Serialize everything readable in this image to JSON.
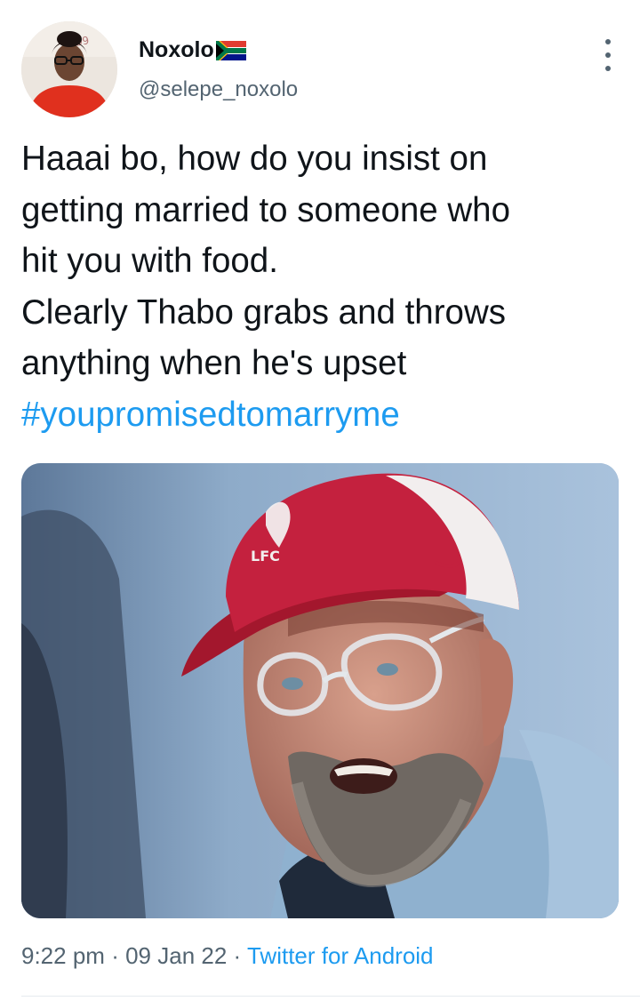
{
  "tweet": {
    "display_name": "Noxolo",
    "flag_icon": "south-africa-flag-icon",
    "handle": "@selepe_noxolo",
    "text_lines": [
      "Haaai bo, how do you insist on",
      "getting married to someone who",
      "hit you with food.",
      "Clearly Thabo grabs and throws",
      "anything when he's upset"
    ],
    "hashtag": "#youpromisedtomarryme",
    "cap_text": "LFC",
    "time": "9:22 pm",
    "separator": "·",
    "date": "09 Jan 22",
    "source": "Twitter for Android"
  },
  "colors": {
    "text": "#0f1419",
    "secondary": "#536471",
    "link": "#1d9bf0",
    "divider": "#e6ebef"
  },
  "icons": {
    "more": "more-vertical-icon"
  }
}
